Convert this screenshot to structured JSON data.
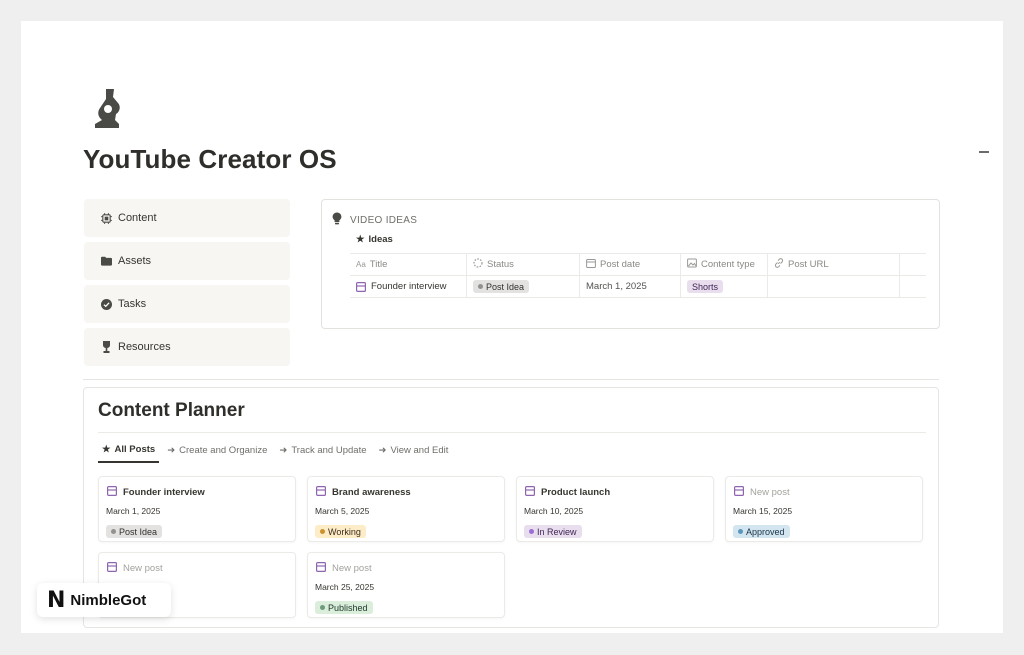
{
  "page": {
    "title": "YouTube Creator OS"
  },
  "nav": [
    {
      "label": "Content",
      "icon": "cpu-icon"
    },
    {
      "label": "Assets",
      "icon": "folder-icon"
    },
    {
      "label": "Tasks",
      "icon": "check-circle-icon"
    },
    {
      "label": "Resources",
      "icon": "trophy-icon"
    }
  ],
  "ideas": {
    "heading": "VIDEO IDEAS",
    "view_label": "Ideas",
    "columns": [
      "Title",
      "Status",
      "Post date",
      "Content type",
      "Post URL"
    ],
    "rows": [
      {
        "title": "Founder interview",
        "status": "Post Idea",
        "date": "March 1, 2025",
        "type": "Shorts",
        "url": ""
      }
    ]
  },
  "planner": {
    "title": "Content Planner",
    "tabs": [
      "All Posts",
      "Create and Organize",
      "Track and Update",
      "View and Edit"
    ],
    "cards": [
      {
        "title": "Founder interview",
        "date": "March 1, 2025",
        "status": "Post Idea",
        "muted": false
      },
      {
        "title": "Brand awareness",
        "date": "March 5, 2025",
        "status": "Working",
        "muted": false
      },
      {
        "title": "Product launch",
        "date": "March 10, 2025",
        "status": "In Review",
        "muted": false
      },
      {
        "title": "New post",
        "date": "March 15, 2025",
        "status": "Approved",
        "muted": true
      },
      {
        "title": "New post",
        "date": "",
        "status": "",
        "muted": true
      },
      {
        "title": "New post",
        "date": "March 25, 2025",
        "status": "Published",
        "muted": true
      }
    ]
  },
  "status_colors": {
    "Post Idea": {
      "bg": "#e3e2e0",
      "dot": "#91918e",
      "fg": "#32302c"
    },
    "Working": {
      "bg": "#fdecc8",
      "dot": "#cb912f",
      "fg": "#402c1b"
    },
    "In Review": {
      "bg": "#e8deee",
      "dot": "#9a6dd7",
      "fg": "#412454"
    },
    "Approved": {
      "bg": "#d3e5ef",
      "dot": "#5b97bd",
      "fg": "#183347"
    },
    "Published": {
      "bg": "#dbeddb",
      "dot": "#6c9b7d",
      "fg": "#1c3829"
    },
    "Shorts": {
      "bg": "#e8deee",
      "fg": "#412454"
    }
  },
  "brand": {
    "name": "NimbleGot",
    "mark": "N"
  }
}
